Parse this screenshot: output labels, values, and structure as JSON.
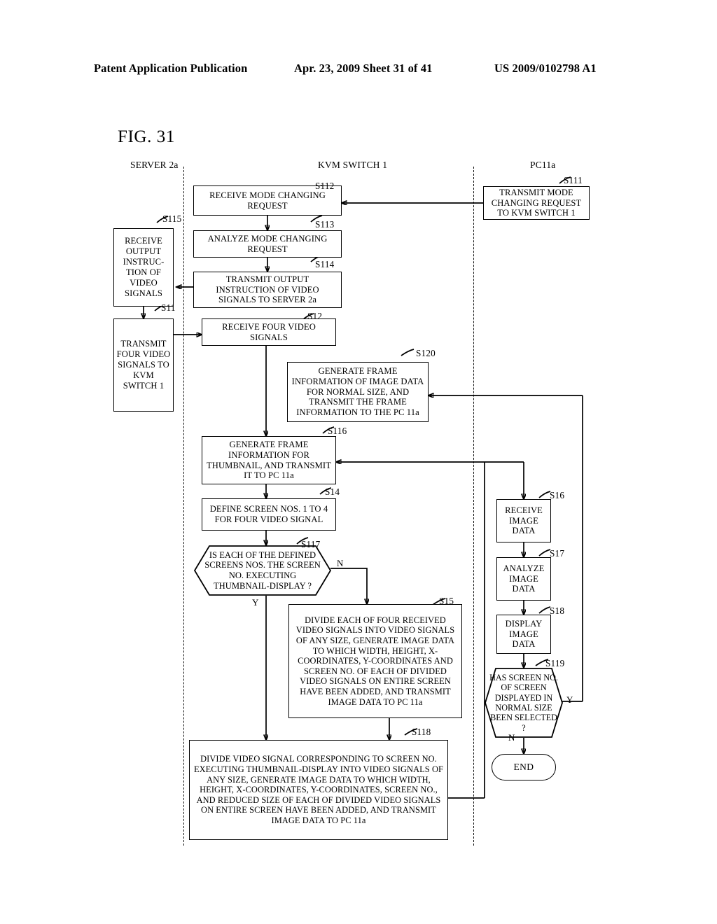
{
  "header": {
    "left": "Patent Application Publication",
    "middle": "Apr. 23, 2009  Sheet 31 of 41",
    "right": "US 2009/0102798 A1"
  },
  "figure": {
    "label": "FIG. 31"
  },
  "lanes": [
    {
      "id": "server",
      "title": "SERVER 2a"
    },
    {
      "id": "kvm",
      "title": "KVM SWITCH 1"
    },
    {
      "id": "pc",
      "title": "PC11a"
    }
  ],
  "nodes": {
    "s111": {
      "tag": "S111",
      "text": "TRANSMIT MODE CHANGING REQUEST TO KVM SWITCH 1"
    },
    "s112": {
      "tag": "S112",
      "text": "RECEIVE MODE CHANGING REQUEST"
    },
    "s113": {
      "tag": "S113",
      "text": "ANALYZE MODE CHANGING REQUEST"
    },
    "s114": {
      "tag": "S114",
      "text": "TRANSMIT OUTPUT INSTRUCTION OF VIDEO SIGNALS TO SERVER 2a"
    },
    "s115": {
      "tag": "S115",
      "text": "RECEIVE OUTPUT INSTRUC-TION OF VIDEO SIGNALS"
    },
    "s11": {
      "tag": "S11",
      "text": "TRANSMIT FOUR VIDEO SIGNALS TO KVM SWITCH 1"
    },
    "s12": {
      "tag": "S12",
      "text": "RECEIVE FOUR VIDEO SIGNALS"
    },
    "s120": {
      "tag": "S120",
      "text": "GENERATE FRAME INFORMATION OF IMAGE DATA FOR NORMAL SIZE, AND TRANSMIT THE FRAME INFORMATION TO THE PC 11a"
    },
    "s116": {
      "tag": "S116",
      "text": "GENERATE FRAME INFORMATION FOR THUMBNAIL, AND TRANSMIT IT TO PC 11a"
    },
    "s14": {
      "tag": "S14",
      "text": "DEFINE SCREEN NOS. 1 TO 4 FOR FOUR VIDEO SIGNAL"
    },
    "s117": {
      "tag": "S117",
      "text": "IS EACH OF THE DEFINED SCREENS NOS. THE SCREEN NO. EXECUTING THUMBNAIL-DISPLAY ?",
      "yes": "Y",
      "no": "N"
    },
    "s15": {
      "tag": "S15",
      "text": "DIVIDE EACH OF FOUR RECEIVED VIDEO SIGNALS INTO VIDEO SIGNALS OF ANY SIZE, GENERATE IMAGE DATA TO WHICH WIDTH, HEIGHT, X-COORDINATES, Y-COORDINATES AND SCREEN NO. OF EACH OF DIVIDED VIDEO SIGNALS ON ENTIRE SCREEN HAVE BEEN ADDED, AND TRANSMIT IMAGE DATA TO PC 11a"
    },
    "s118": {
      "tag": "S118",
      "text": "DIVIDE VIDEO SIGNAL CORRESPONDING TO SCREEN NO. EXECUTING THUMBNAIL-DISPLAY INTO VIDEO SIGNALS OF ANY SIZE, GENERATE IMAGE DATA TO WHICH WIDTH, HEIGHT, X-COORDINATES, Y-COORDINATES, SCREEN NO., AND REDUCED SIZE OF EACH OF DIVIDED VIDEO SIGNALS ON ENTIRE SCREEN HAVE BEEN ADDED, AND TRANSMIT IMAGE DATA TO PC 11a"
    },
    "s16": {
      "tag": "S16",
      "text": "RECEIVE IMAGE DATA"
    },
    "s17": {
      "tag": "S17",
      "text": "ANALYZE IMAGE DATA"
    },
    "s18": {
      "tag": "S18",
      "text": "DISPLAY IMAGE DATA"
    },
    "s119": {
      "tag": "S119",
      "text": "HAS SCREEN NO. OF SCREEN DISPLAYED IN NORMAL SIZE BEEN SELECTED ?",
      "yes": "Y",
      "no": "N"
    },
    "end": {
      "text": "END"
    }
  },
  "colors": {
    "ink": "#000000",
    "paper": "#ffffff"
  }
}
